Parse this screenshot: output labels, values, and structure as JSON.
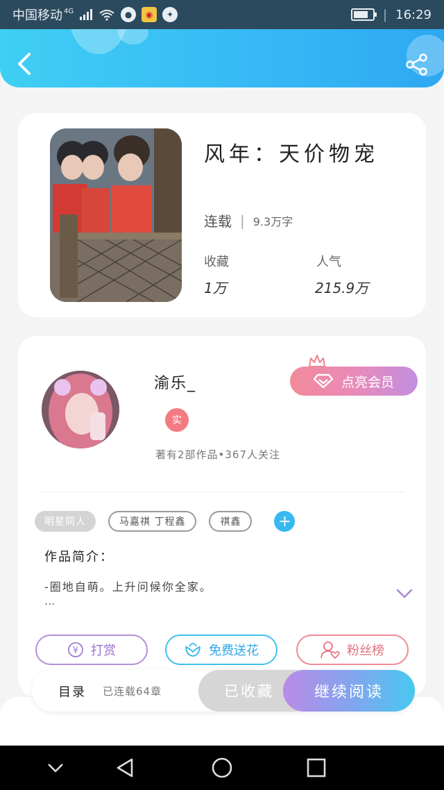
{
  "status_bar": {
    "carrier": "中国移动",
    "network": "4G",
    "time": "16:29",
    "battery_level": 0.75
  },
  "header": {
    "back_icon": "chevron-left-icon",
    "share_icon": "share-icon"
  },
  "book": {
    "title": "风年：天价物宠",
    "status": "连载",
    "word_count": "9.3万字",
    "favorites_label": "收藏",
    "favorites_value": "1万",
    "popularity_label": "人气",
    "popularity_value": "215.9万"
  },
  "author": {
    "name": "渝乐_",
    "verified_badge": "实",
    "stats": "著有2部作品•367人关注",
    "vip_button": "点亮会员"
  },
  "tags": [
    "明星同人",
    "马嘉祺 丁程鑫",
    "祺鑫"
  ],
  "intro": {
    "title": "作品简介：",
    "text": "-圈地自萌。上升问候你全家。",
    "more": "..."
  },
  "actions": {
    "tip": "打赏",
    "flower": "免费送花",
    "fans": "粉丝榜"
  },
  "bottom": {
    "catalog": "目录",
    "chapters": "已连载64章",
    "favorited": "已收藏",
    "read": "继续阅读"
  },
  "colors": {
    "header_start": "#3fcff3",
    "header_end": "#2ea8f2",
    "vip_gradient": [
      "#f28a9a",
      "#c28ee0"
    ],
    "read_gradient": [
      "#b98be6",
      "#48c8f0"
    ]
  }
}
